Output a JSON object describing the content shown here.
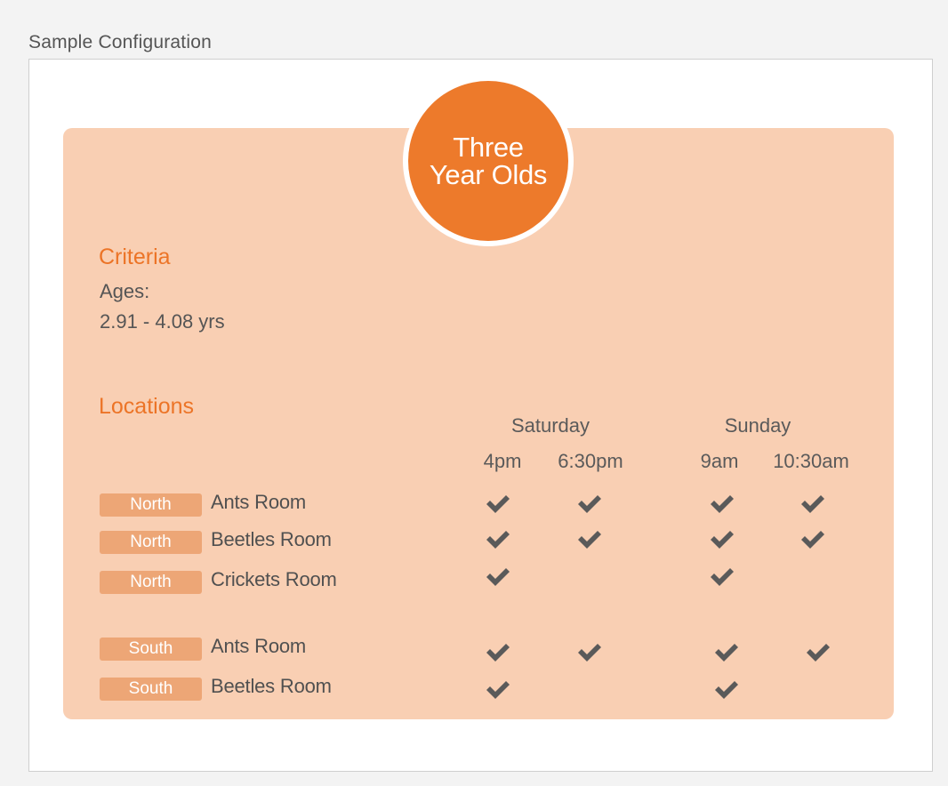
{
  "panel": {
    "title": "Sample Configuration"
  },
  "group": {
    "name_line1": "Three",
    "name_line2": "Year Olds"
  },
  "criteria": {
    "heading": "Criteria",
    "label": "Ages:",
    "value": "2.91 - 4.08 yrs"
  },
  "locations": {
    "heading": "Locations",
    "days": [
      "Saturday",
      "Sunday"
    ],
    "times": [
      "4pm",
      "6:30pm",
      "9am",
      "10:30am"
    ],
    "rows": [
      {
        "campus": "North",
        "room": "Ants Room",
        "checks": [
          true,
          true,
          true,
          true
        ]
      },
      {
        "campus": "North",
        "room": "Beetles Room",
        "checks": [
          true,
          true,
          true,
          true
        ]
      },
      {
        "campus": "North",
        "room": "Crickets Room",
        "checks": [
          true,
          false,
          true,
          false
        ]
      },
      {
        "campus": "South",
        "room": "Ants Room",
        "checks": [
          true,
          true,
          true,
          true
        ]
      },
      {
        "campus": "South",
        "room": "Beetles Room",
        "checks": [
          true,
          false,
          true,
          false
        ]
      }
    ]
  },
  "icons": {
    "check": "checkmark-icon"
  },
  "colors": {
    "accent": "#ed7a2b",
    "card_bg": "#f9cfb3",
    "badge_bg": "#eda676",
    "check": "#5a5a5a"
  }
}
